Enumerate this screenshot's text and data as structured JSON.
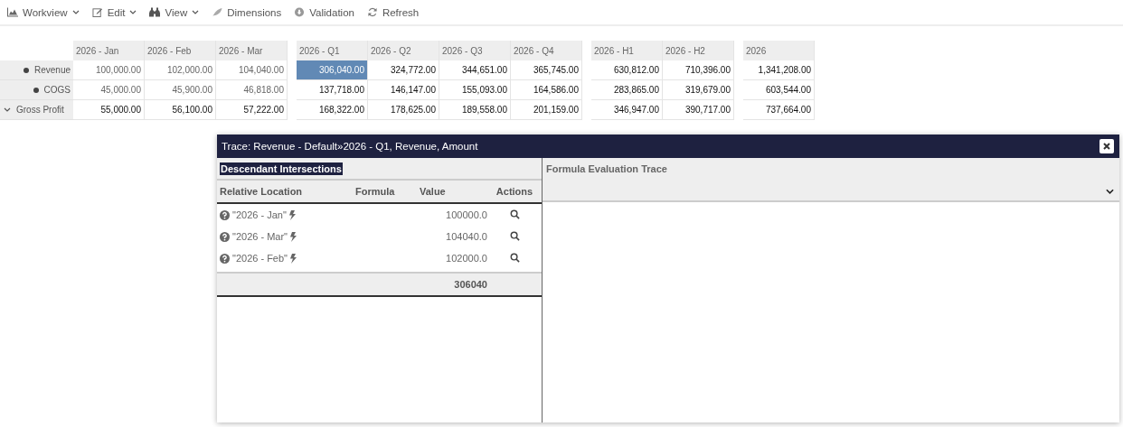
{
  "toolbar": [
    {
      "label": "Workview",
      "kind": "chart",
      "dropdown": true
    },
    {
      "label": "Edit",
      "kind": "edit",
      "dropdown": true
    },
    {
      "label": "View",
      "kind": "binoculars",
      "dropdown": true
    },
    {
      "label": "Dimensions",
      "kind": "leaf",
      "dropdown": false
    },
    {
      "label": "Validation",
      "kind": "download",
      "dropdown": false
    },
    {
      "label": "Refresh",
      "kind": "refresh",
      "dropdown": false
    }
  ],
  "grid": {
    "column_groups": [
      [
        "2026 - Jan",
        "2026 - Feb",
        "2026 - Mar"
      ],
      [
        "2026 - Q1",
        "2026 - Q2",
        "2026 - Q3",
        "2026 - Q4"
      ],
      [
        "2026 - H1",
        "2026 - H2"
      ],
      [
        "2026"
      ]
    ],
    "rows": [
      {
        "label": "Revenue",
        "kind": "bullet",
        "cells": [
          [
            {
              "value": "100,000.00",
              "input": true,
              "selected": false
            },
            {
              "value": "102,000.00",
              "input": true,
              "selected": false
            },
            {
              "value": "104,040.00",
              "input": true,
              "selected": false
            }
          ],
          [
            {
              "value": "306,040.00",
              "input": false,
              "selected": true
            },
            {
              "value": "324,772.00",
              "input": false,
              "selected": false
            },
            {
              "value": "344,651.00",
              "input": false,
              "selected": false
            },
            {
              "value": "365,745.00",
              "input": false,
              "selected": false
            }
          ],
          [
            {
              "value": "630,812.00",
              "input": false,
              "selected": false
            },
            {
              "value": "710,396.00",
              "input": false,
              "selected": false
            }
          ],
          [
            {
              "value": "1,341,208.00",
              "input": false,
              "selected": false
            }
          ]
        ]
      },
      {
        "label": "COGS",
        "kind": "bullet",
        "cells": [
          [
            {
              "value": "45,000.00",
              "input": true,
              "selected": false
            },
            {
              "value": "45,900.00",
              "input": true,
              "selected": false
            },
            {
              "value": "46,818.00",
              "input": true,
              "selected": false
            }
          ],
          [
            {
              "value": "137,718.00",
              "input": false,
              "selected": false
            },
            {
              "value": "146,147.00",
              "input": false,
              "selected": false
            },
            {
              "value": "155,093.00",
              "input": false,
              "selected": false
            },
            {
              "value": "164,586.00",
              "input": false,
              "selected": false
            }
          ],
          [
            {
              "value": "283,865.00",
              "input": false,
              "selected": false
            },
            {
              "value": "319,679.00",
              "input": false,
              "selected": false
            }
          ],
          [
            {
              "value": "603,544.00",
              "input": false,
              "selected": false
            }
          ]
        ]
      },
      {
        "label": "Gross Profit",
        "kind": "expander",
        "cells": [
          [
            {
              "value": "55,000.00",
              "input": false,
              "selected": false
            },
            {
              "value": "56,100.00",
              "input": false,
              "selected": false
            },
            {
              "value": "57,222.00",
              "input": false,
              "selected": false
            }
          ],
          [
            {
              "value": "168,322.00",
              "input": false,
              "selected": false
            },
            {
              "value": "178,625.00",
              "input": false,
              "selected": false
            },
            {
              "value": "189,558.00",
              "input": false,
              "selected": false
            },
            {
              "value": "201,159.00",
              "input": false,
              "selected": false
            }
          ],
          [
            {
              "value": "346,947.00",
              "input": false,
              "selected": false
            },
            {
              "value": "390,717.00",
              "input": false,
              "selected": false
            }
          ],
          [
            {
              "value": "737,664.00",
              "input": false,
              "selected": false
            }
          ]
        ]
      }
    ]
  },
  "trace": {
    "title": "Trace: Revenue - Default»2026 - Q1, Revenue, Amount",
    "left": {
      "heading": "Descendant Intersections",
      "columns": [
        "Relative Location",
        "Formula",
        "Value",
        "Actions"
      ],
      "rows": [
        {
          "location": "\"2026 - Jan\"",
          "value": "100000.0"
        },
        {
          "location": "\"2026 - Mar\"",
          "value": "104040.0"
        },
        {
          "location": "\"2026 - Feb\"",
          "value": "102000.0"
        }
      ],
      "total": "306040"
    },
    "right": {
      "heading": "Formula Evaluation Trace"
    }
  }
}
